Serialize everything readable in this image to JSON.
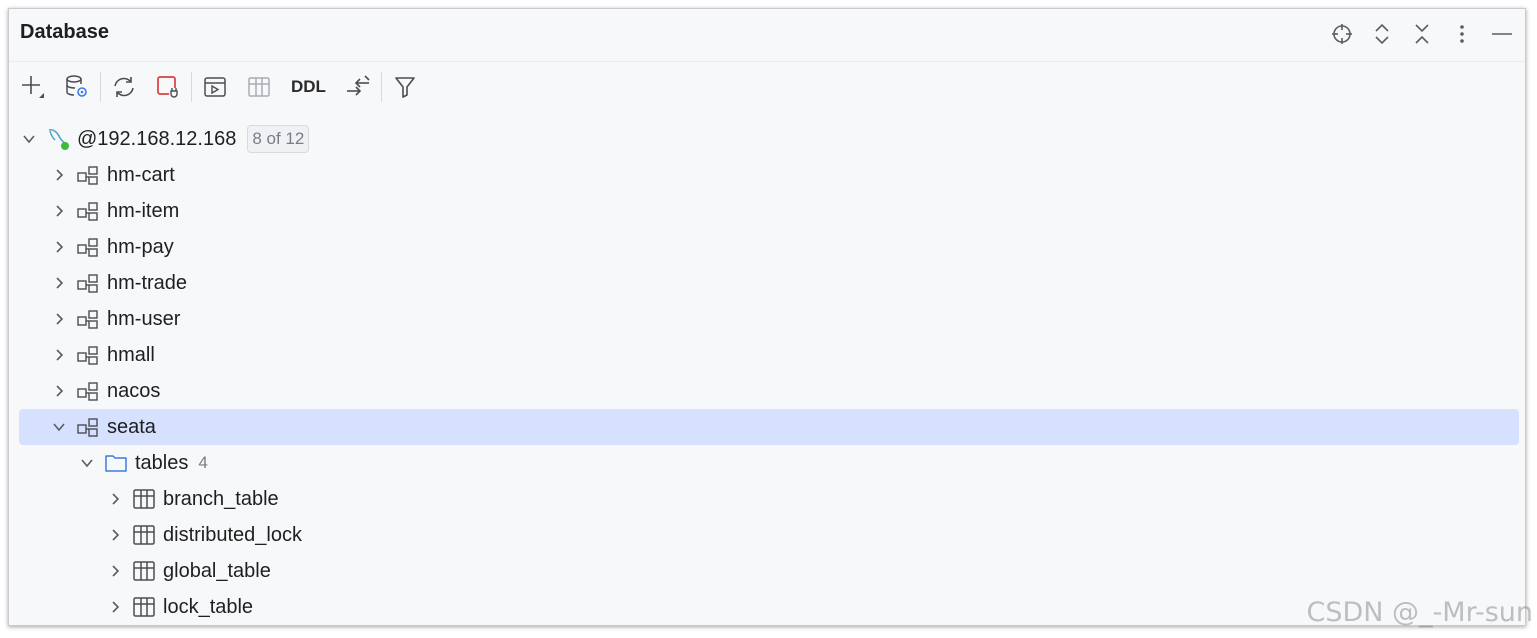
{
  "panel": {
    "title": "Database"
  },
  "header_icons": [
    {
      "name": "locate-icon"
    },
    {
      "name": "expand-collapse-icon"
    },
    {
      "name": "collapse-all-icon"
    },
    {
      "name": "more-options-icon"
    },
    {
      "name": "minimize-icon"
    }
  ],
  "toolbar": {
    "ddl_label": "DDL"
  },
  "tree": {
    "connection": {
      "label": "@192.168.12.168",
      "badge": "8 of 12"
    },
    "schemas": [
      {
        "label": "hm-cart"
      },
      {
        "label": "hm-item"
      },
      {
        "label": "hm-pay"
      },
      {
        "label": "hm-trade"
      },
      {
        "label": "hm-user"
      },
      {
        "label": "hmall"
      },
      {
        "label": "nacos"
      },
      {
        "label": "seata"
      }
    ],
    "tables_folder": {
      "label": "tables",
      "count": "4"
    },
    "tables": [
      {
        "label": "branch_table"
      },
      {
        "label": "distributed_lock"
      },
      {
        "label": "global_table"
      },
      {
        "label": "lock_table"
      }
    ]
  },
  "watermark": "CSDN @_-Mr-sun",
  "colors": {
    "selection": "#d5e1ff",
    "connection_status": "#3dbb3d",
    "error_red": "#d93f3f",
    "folder_blue": "#3d7ae5"
  }
}
